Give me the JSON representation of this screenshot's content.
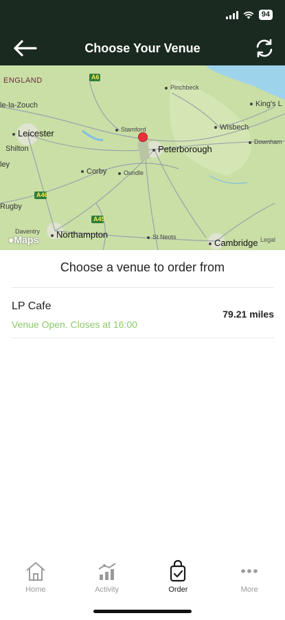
{
  "status_bar": {
    "battery": "94"
  },
  "header": {
    "title": "Choose Your Venue"
  },
  "map": {
    "labels": {
      "england": "ENGLAND",
      "ashby": "le-la-Zouch",
      "leicester": "Leicester",
      "shilton": "Shilton",
      "lley": "ley",
      "rugby": "Rugby",
      "daventry": "Daventry",
      "northampton": "Northampton",
      "corby": "Corby",
      "oundle": "Oundle",
      "stamford": "Stamford",
      "peterborough": "Peterborough",
      "pinchbeck": "Pinchbeck",
      "wisbech": "Wisbech",
      "kingsl": "King's L",
      "downham": "Downham",
      "stneots": "St Neots",
      "cambridge": "Cambridge",
      "road_a6": "A6",
      "road_a46": "A46",
      "road_a45": "A45"
    },
    "maps_logo": "Maps",
    "legal": "Legal"
  },
  "main": {
    "subtitle": "Choose a venue to order from",
    "venues": [
      {
        "name": "LP Cafe",
        "status": "Venue Open. Closes at 16:00",
        "distance": "79.21 miles"
      }
    ]
  },
  "tabbar": {
    "tabs": [
      {
        "label": "Home",
        "icon": "home-icon"
      },
      {
        "label": "Activity",
        "icon": "activity-icon"
      },
      {
        "label": "Order",
        "icon": "order-bag-icon"
      },
      {
        "label": "More",
        "icon": "more-dots-icon"
      }
    ],
    "active": "Order"
  },
  "colors": {
    "header_bg": "#1a2a20",
    "accent_green": "#8cc96b",
    "pin_red": "#e8323a",
    "map_land": "#c9dfa6"
  }
}
